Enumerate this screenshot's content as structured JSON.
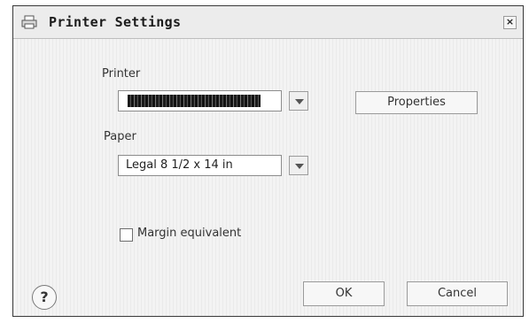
{
  "window": {
    "title": "Printer Settings",
    "close_glyph": "×"
  },
  "printer": {
    "label": "Printer",
    "selected_value": "[redacted printer name]",
    "dropdown_glyph": "▼"
  },
  "properties_button": {
    "label": "Properties"
  },
  "paper": {
    "label": "Paper",
    "selected_value": "Legal 8 1/2 x 14 in",
    "dropdown_glyph": "▼"
  },
  "margin_equivalent": {
    "label": "Margin equivalent",
    "checked": false
  },
  "footer": {
    "help_glyph": "?",
    "ok_label": "OK",
    "cancel_label": "Cancel"
  },
  "icons": {
    "title_icon": "printer-icon",
    "close_icon": "close-icon",
    "help_icon": "help-icon",
    "dropdown_icon": "chevron-down-icon"
  }
}
